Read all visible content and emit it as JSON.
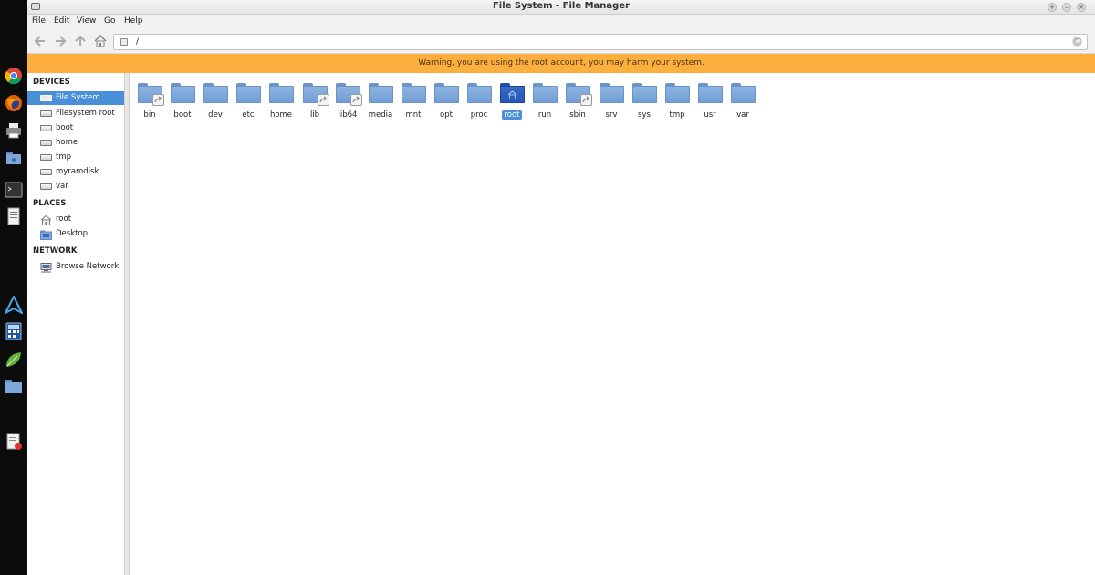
{
  "window": {
    "title": "File System - File Manager"
  },
  "menubar": [
    "File",
    "Edit",
    "View",
    "Go",
    "Help"
  ],
  "location": {
    "path": "/"
  },
  "warning": "Warning, you are using the root account, you may harm your system.",
  "sidebar": {
    "devices_heading": "DEVICES",
    "devices": [
      "File System",
      "Filesystem root",
      "boot",
      "home",
      "tmp",
      "myramdisk",
      "var"
    ],
    "places_heading": "PLACES",
    "places": [
      "root",
      "Desktop"
    ],
    "network_heading": "NETWORK",
    "network": [
      "Browse Network"
    ],
    "selected": "File System"
  },
  "files": [
    {
      "name": "bin",
      "symlink": true
    },
    {
      "name": "boot",
      "symlink": false
    },
    {
      "name": "dev",
      "symlink": false
    },
    {
      "name": "etc",
      "symlink": false
    },
    {
      "name": "home",
      "symlink": false
    },
    {
      "name": "lib",
      "symlink": true
    },
    {
      "name": "lib64",
      "symlink": true
    },
    {
      "name": "media",
      "symlink": false
    },
    {
      "name": "mnt",
      "symlink": false
    },
    {
      "name": "opt",
      "symlink": false
    },
    {
      "name": "proc",
      "symlink": false
    },
    {
      "name": "root",
      "symlink": false,
      "home_folder": true,
      "selected": true
    },
    {
      "name": "run",
      "symlink": false
    },
    {
      "name": "sbin",
      "symlink": true
    },
    {
      "name": "srv",
      "symlink": false
    },
    {
      "name": "sys",
      "symlink": false
    },
    {
      "name": "tmp",
      "symlink": false
    },
    {
      "name": "usr",
      "symlink": false
    },
    {
      "name": "var",
      "symlink": false
    }
  ],
  "dock": [
    "chrome-icon",
    "firefox-icon",
    "printer-icon",
    "file-manager-icon",
    "terminal-icon",
    "text-editor-icon",
    "arch-icon",
    "calculator-icon",
    "leaf-icon",
    "folder-icon",
    "document-viewer-icon"
  ],
  "colors": {
    "warning_bg": "#fcaf3e",
    "selection": "#4a90d9",
    "folder": "#7ea6d8",
    "home_folder": "#2a5bb8"
  }
}
